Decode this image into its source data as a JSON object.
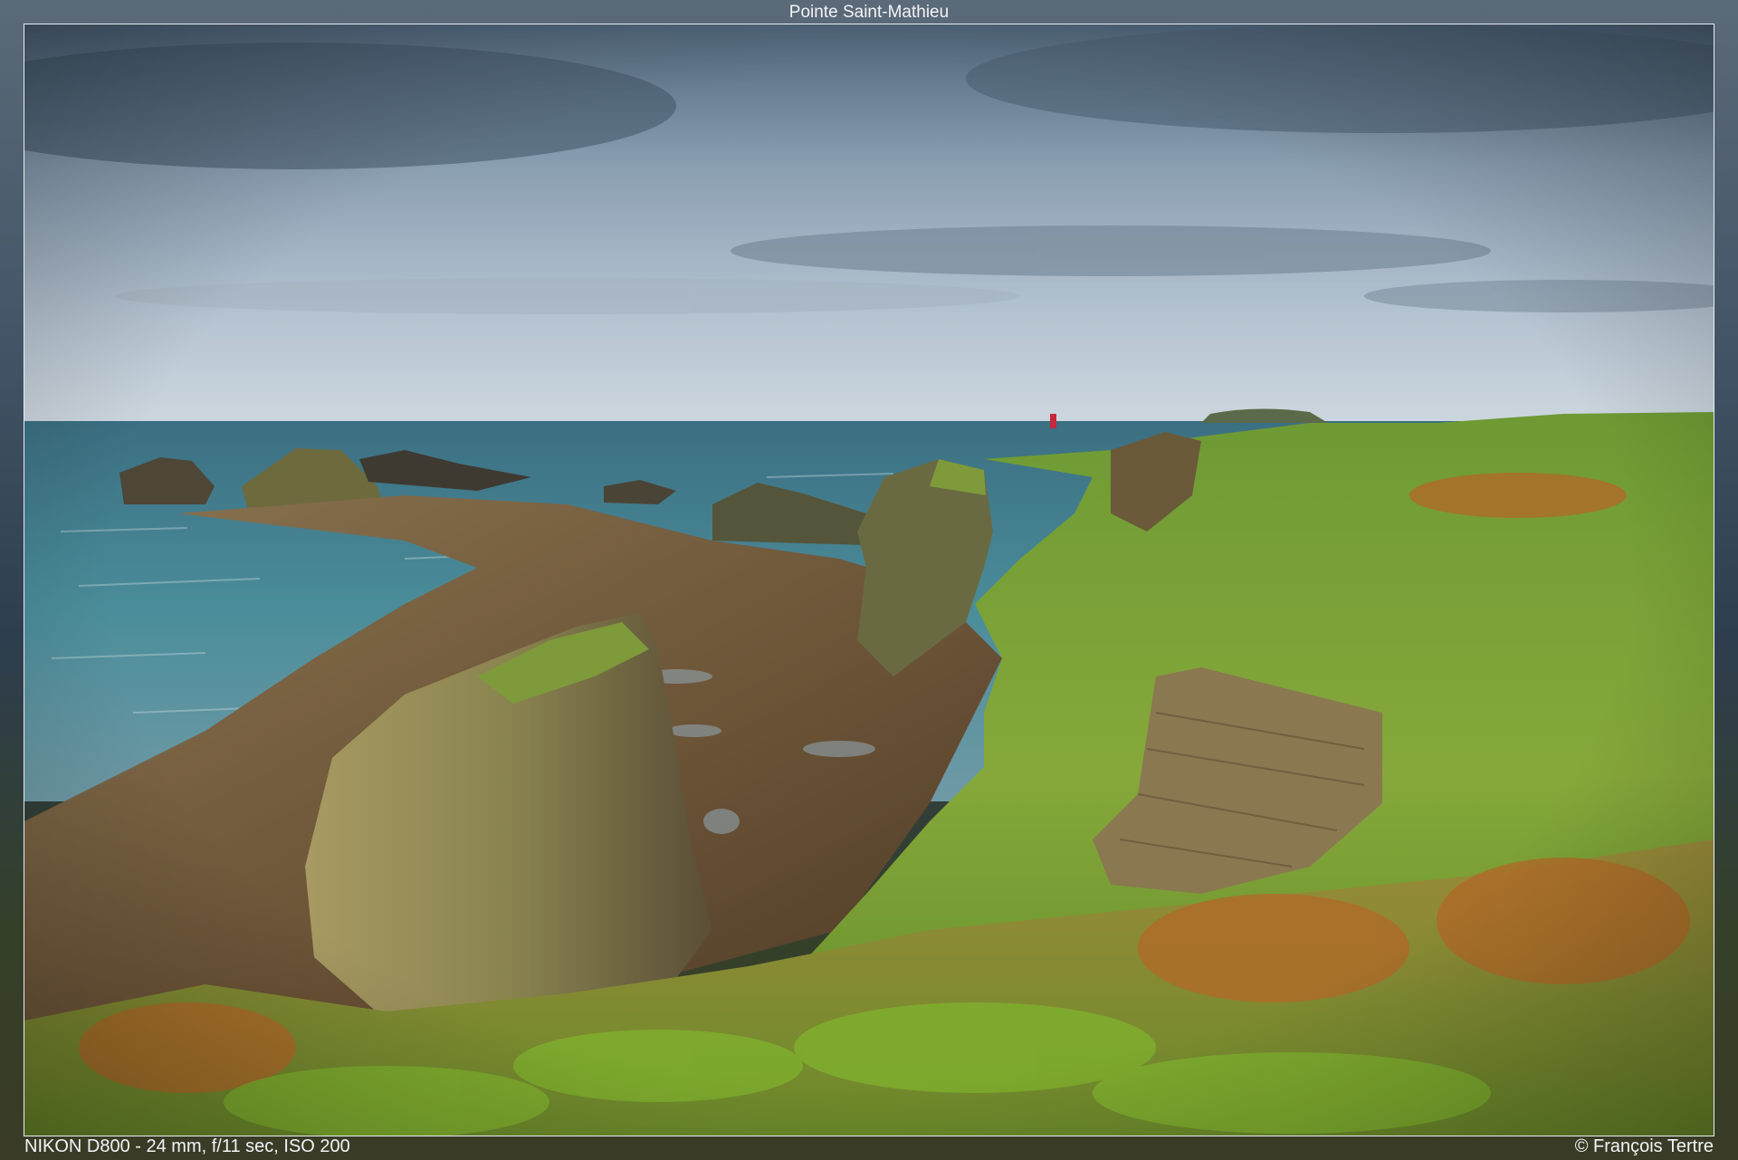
{
  "photo": {
    "title": "Pointe Saint-Mathieu",
    "exif": "NIKON D800 - 24 mm, f/11 sec, ISO 200",
    "copyright": "© François Tertre"
  },
  "colors": {
    "sky_top": "#52677f",
    "sky_mid": "#9fb1c3",
    "sky_horizon": "#c8d3dd",
    "sea": "#3f7d8c",
    "rock": "#7a5a3a",
    "grass": "#7fa23a",
    "fern": "#8aa83a",
    "bracken": "#b06a28",
    "buoy": "#c8283a"
  }
}
